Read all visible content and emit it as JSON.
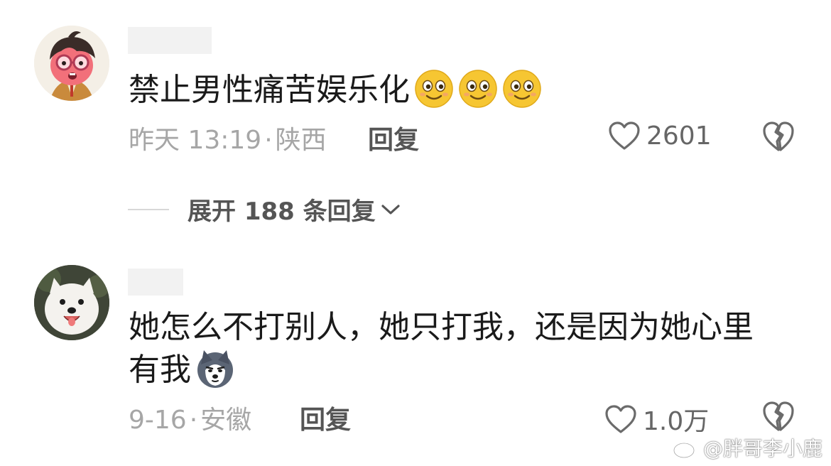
{
  "comments": [
    {
      "text": "禁止男性痛苦娱乐化",
      "emojis": [
        "smile-emoji",
        "smile-emoji",
        "smile-emoji"
      ],
      "time": "昨天 13:19",
      "sep": "·",
      "location": "陕西",
      "reply_label": "回复",
      "likes": "2601"
    },
    {
      "text_line1": "她怎么不打别人，她只打我，还是因为她心里",
      "text_line2": "有我",
      "emojis": [
        "husky-emoji"
      ],
      "time": "9-16",
      "sep": "·",
      "location": "安徽",
      "reply_label": "回复",
      "likes": "1.0万"
    }
  ],
  "expand_replies": {
    "label": "展开 188 条回复"
  },
  "watermark": {
    "text": "@胖哥李小鹿",
    "icon": "weibo-icon"
  },
  "colors": {
    "text_primary": "#1a1a1a",
    "text_meta": "#a6a6a6",
    "text_action": "#555555",
    "emoji_yellow": "#f6c632"
  }
}
